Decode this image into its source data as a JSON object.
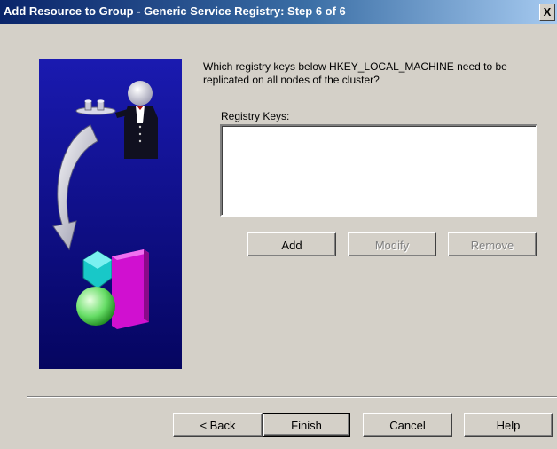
{
  "window": {
    "title": "Add Resource to Group - Generic Service Registry:  Step 6 of 6",
    "close_label": "X"
  },
  "content": {
    "question": "Which registry keys below HKEY_LOCAL_MACHINE need to be replicated on all nodes of the cluster?",
    "list_label": "Registry Keys:",
    "registry_keys": []
  },
  "list_buttons": {
    "add": "Add",
    "modify": "Modify",
    "remove": "Remove"
  },
  "footer_buttons": {
    "back": "< Back",
    "finish": "Finish",
    "cancel": "Cancel",
    "help": "Help"
  },
  "colors": {
    "titlebar_start": "#0a246a",
    "titlebar_end": "#a6caf0",
    "panel_background": "#0a0a8c",
    "window_face": "#d4d0c8"
  },
  "icons": {
    "side_image": "butler-wizard-illustration"
  }
}
